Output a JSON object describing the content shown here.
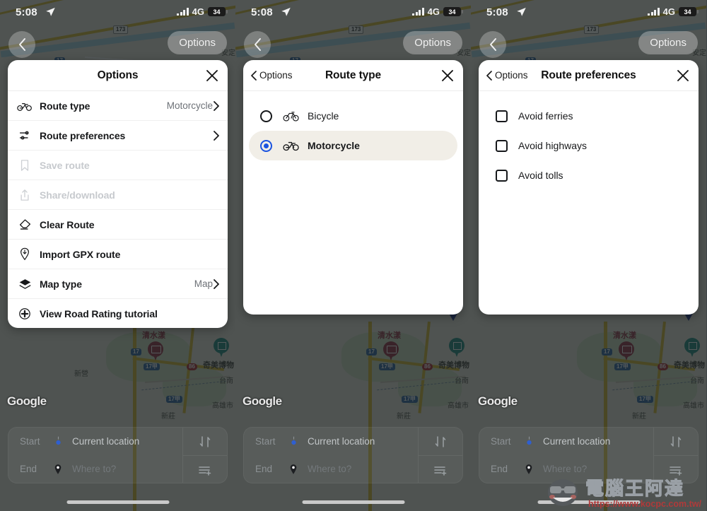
{
  "status_bar": {
    "time": "5:08",
    "location_arrow_icon": "location-arrow-icon",
    "signal_icon": "cellular-signal-icon",
    "network": "4G",
    "battery_level": "34"
  },
  "map": {
    "back_icon": "chevron-left-icon",
    "options_pill_label": "Options",
    "attribution": "Google",
    "labels": [
      {
        "text": "清水漾",
        "type": "poi"
      },
      {
        "text": "奇美博物",
        "type": "poi"
      },
      {
        "text": "台南",
        "type": "place"
      },
      {
        "text": "高雄市",
        "type": "place"
      },
      {
        "text": "新莊",
        "type": "place"
      },
      {
        "text": "安定",
        "type": "place"
      },
      {
        "text": "新營",
        "type": "place"
      }
    ],
    "shields": [
      "173",
      "17",
      "17甲",
      "86",
      "17甲"
    ]
  },
  "panels": [
    {
      "id": "options",
      "header": {
        "title": "Options",
        "back_label": null,
        "close_icon": "close-icon"
      },
      "rows": [
        {
          "icon": "motorcycle-icon",
          "label": "Route type",
          "value": "Motorcycle",
          "chevron": true,
          "disabled": false
        },
        {
          "icon": "sliders-icon",
          "label": "Route preferences",
          "value": "",
          "chevron": true,
          "disabled": false
        },
        {
          "icon": "bookmark-icon",
          "label": "Save route",
          "value": "",
          "chevron": false,
          "disabled": true
        },
        {
          "icon": "share-icon",
          "label": "Share/download",
          "value": "",
          "chevron": false,
          "disabled": true
        },
        {
          "icon": "eraser-icon",
          "label": "Clear Route",
          "value": "",
          "chevron": false,
          "disabled": false
        },
        {
          "icon": "pin-download-icon",
          "label": "Import GPX route",
          "value": "",
          "chevron": false,
          "disabled": false
        },
        {
          "icon": "layers-icon",
          "label": "Map type",
          "value": "Map",
          "chevron": true,
          "disabled": false
        },
        {
          "icon": "plus-circle-icon",
          "label": "View Road Rating tutorial",
          "value": "",
          "chevron": false,
          "disabled": false
        }
      ]
    },
    {
      "id": "route-type",
      "header": {
        "title": "Route type",
        "back_label": "Options",
        "close_icon": "close-icon"
      },
      "options": [
        {
          "label": "Bicycle",
          "icon": "bicycle-icon",
          "selected": false
        },
        {
          "label": "Motorcycle",
          "icon": "motorcycle-icon",
          "selected": true
        }
      ]
    },
    {
      "id": "route-preferences",
      "header": {
        "title": "Route preferences",
        "back_label": "Options",
        "close_icon": "close-icon"
      },
      "checks": [
        {
          "label": "Avoid ferries",
          "checked": false
        },
        {
          "label": "Avoid highways",
          "checked": false
        },
        {
          "label": "Avoid tolls",
          "checked": false
        }
      ]
    }
  ],
  "bottom_bar": {
    "start_label": "Start",
    "start_value": "Current location",
    "start_icon": "current-location-icon",
    "end_label": "End",
    "end_placeholder": "Where to?",
    "end_icon": "destination-pin-icon",
    "swap_icon": "swap-arrows-icon",
    "waypoints_icon": "add-waypoint-icon"
  },
  "watermark": {
    "text": "電腦王阿達",
    "url": "https://www.kocpc.com.tw/"
  },
  "colors": {
    "accent_blue": "#1a53e0",
    "selected_row": "#f1eee7",
    "sheet_bg": "#ffffff",
    "disabled_text": "#c7cace",
    "map_dim": "rgba(20,26,28,0.72)"
  }
}
